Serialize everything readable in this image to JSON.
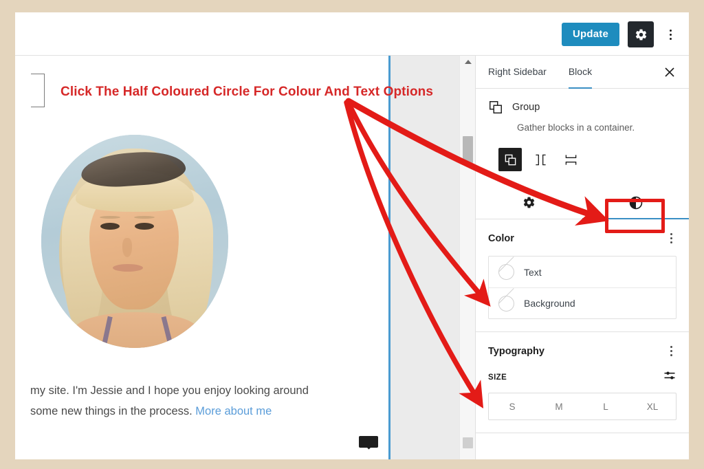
{
  "window": {
    "frame_color": "#e4d5bd",
    "background": "#ffffff"
  },
  "topbar": {
    "update_label": "Update",
    "settings_icon": "gear-icon",
    "more_icon": "kebab-menu-icon",
    "accent_color": "#1e8cbe"
  },
  "annotation": {
    "headline": "Click The Half Coloured Circle For Colour And Text Options",
    "color": "#d62828",
    "arrow_color": "#e31b17",
    "highlight_color": "#e31b17",
    "arrows": [
      {
        "target": "contrast-style-tab"
      },
      {
        "target": "color-panel-text-row"
      },
      {
        "target": "typography-size-label"
      }
    ]
  },
  "canvas": {
    "paragraph_line1": "my site. I'm Jessie and I hope you enjoy looking around",
    "paragraph_line2_before": "some new things in the process. ",
    "paragraph_link": "More about me",
    "link_color": "#5b9dd9",
    "avatar_alt": "profile-photo",
    "selection_line_color": "#4a9bd1"
  },
  "scrollbar": {
    "up_arrow_icon": "scroll-up-arrow-icon"
  },
  "sidebar": {
    "tabs": [
      {
        "label": "Right Sidebar",
        "active": false
      },
      {
        "label": "Block",
        "active": true
      }
    ],
    "close_icon": "close-icon",
    "block": {
      "icon": "group-block-icon",
      "title": "Group",
      "description": "Gather blocks in a container."
    },
    "variations": [
      {
        "name": "group-variation",
        "icon": "group-icon",
        "selected": true
      },
      {
        "name": "row-variation",
        "icon": "row-icon",
        "selected": false
      },
      {
        "name": "stack-variation",
        "icon": "stack-icon",
        "selected": false
      }
    ],
    "style_tabs": [
      {
        "name": "settings-tab",
        "icon": "gear-icon",
        "active": false
      },
      {
        "name": "styles-tab",
        "icon": "half-filled-circle-icon",
        "active": true
      }
    ],
    "color_panel": {
      "title": "Color",
      "menu_icon": "kebab-menu-icon",
      "rows": [
        {
          "label": "Text",
          "swatch": "empty-color-swatch"
        },
        {
          "label": "Background",
          "swatch": "empty-color-swatch"
        }
      ]
    },
    "typography_panel": {
      "title": "Typography",
      "menu_icon": "kebab-menu-icon",
      "size_label": "SIZE",
      "size_settings_icon": "sliders-icon",
      "size_options": [
        "S",
        "M",
        "L",
        "XL"
      ]
    }
  }
}
